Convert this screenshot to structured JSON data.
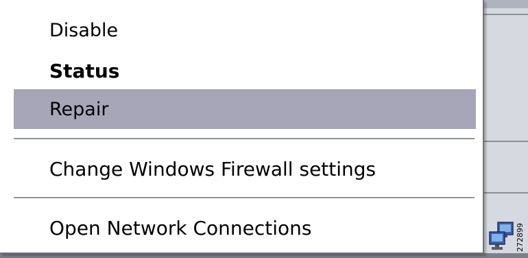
{
  "context_menu": {
    "items": [
      {
        "label": "Disable"
      },
      {
        "label": "Status"
      },
      {
        "label": "Repair"
      },
      {
        "label": "Change Windows Firewall settings"
      },
      {
        "label": "Open Network Connections"
      }
    ],
    "highlight_color": "#a7a6b8"
  },
  "tray": {
    "icon": "network-connections-icon"
  },
  "figure_id": "272899"
}
